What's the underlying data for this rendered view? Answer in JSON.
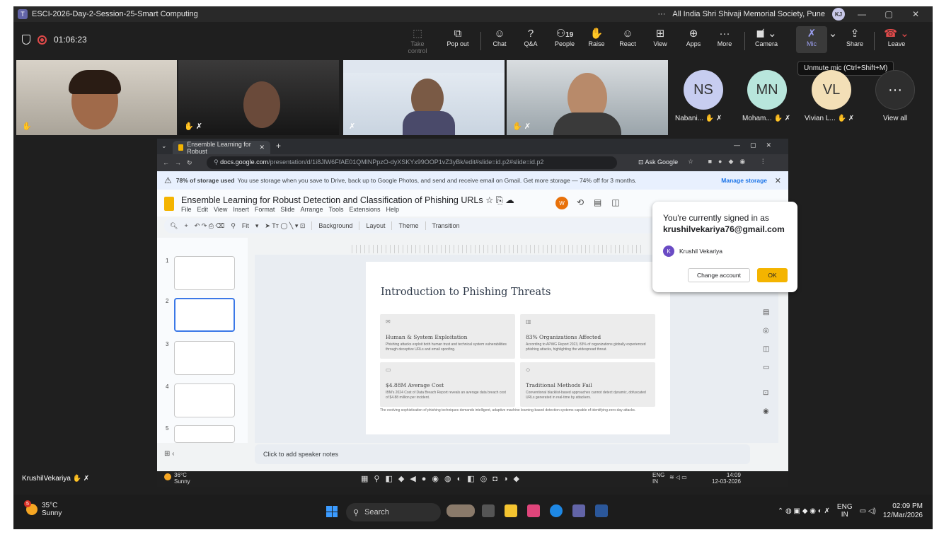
{
  "window": {
    "title": "ESCI-2026-Day-2-Session-25-Smart Computing",
    "org": "All India Shri Shivaji Memorial Society, Pune",
    "user_initials": "KJ"
  },
  "meeting": {
    "timer": "01:06:23"
  },
  "toolbar": {
    "take_control": "Take control",
    "pop_out": "Pop out",
    "chat": "Chat",
    "qa": "Q&A",
    "people": "People",
    "people_count": "19",
    "raise": "Raise",
    "react": "React",
    "view": "View",
    "apps": "Apps",
    "more": "More",
    "camera": "Camera",
    "mic": "Mic",
    "share": "Share",
    "leave": "Leave",
    "tooltip": "Unmute mic (Ctrl+Shift+M)"
  },
  "participants": [
    {
      "initials": "NS",
      "name": "Nabani...",
      "color": "#c7cdf0"
    },
    {
      "initials": "MN",
      "name": "Moham...",
      "color": "#b8e6dc"
    },
    {
      "initials": "VL",
      "name": "Vivian L...",
      "color": "#f3dfb7"
    }
  ],
  "view_all": "View all",
  "self_label": "KrushilVekariya",
  "browser": {
    "tab_title": "Ensemble Learning for Robust",
    "url_domain": "docs.google.com",
    "url_path": "/presentation/d/1i8JlW6FfAE01QMlNPpzO-dyXSKYx99OOP1vZ3yBk/edit#slide=id.p2#slide=id.p2",
    "ask_google": "Ask Google",
    "banner_strong": "78% of storage used",
    "banner_text": "You use storage when you save to Drive, back up to Google Photos, and send and receive email on Gmail. Get more storage — 74% off for 3 months.",
    "manage_storage": "Manage storage"
  },
  "doc": {
    "title": "Ensemble Learning for Robust Detection and Classification of Phishing URLs",
    "menus": [
      "File",
      "Edit",
      "View",
      "Insert",
      "Format",
      "Slide",
      "Arrange",
      "Tools",
      "Extensions",
      "Help"
    ],
    "edit_tools": {
      "fit": "Fit",
      "background": "Background",
      "layout": "Layout",
      "theme": "Theme",
      "transition": "Transition"
    },
    "slide_numbers": [
      "1",
      "2",
      "3",
      "4",
      "5"
    ],
    "speaker_notes": "Click to add speaker notes"
  },
  "slide": {
    "title": "Introduction to Phishing Threats",
    "cards": [
      {
        "heading": "Human & System Exploitation",
        "body": "Phishing attacks exploit both human trust and technical system vulnerabilities through deceptive URLs and email spoofing."
      },
      {
        "heading": "83% Organizations Affected",
        "body": "According to APWG Report 2023, 83% of organizations globally experienced phishing attacks, highlighting the widespread threat."
      },
      {
        "heading": "$4.88M Average Cost",
        "body": "IBM's 2024 Cost of Data Breach Report reveals an average data breach cost of $4.88 million per incident."
      },
      {
        "heading": "Traditional Methods Fail",
        "body": "Conventional blacklist-based approaches cannot detect dynamic, obfuscated URLs generated in real-time by attackers."
      }
    ],
    "footer": "The evolving sophistication of phishing techniques demands intelligent, adaptive machine learning-based detection systems capable of identifying zero-day attacks."
  },
  "popup": {
    "line1": "You're currently signed in as",
    "email": "krushilvekariya76@gmail.com",
    "name": "Krushil Vekariya",
    "avatar": "K",
    "change": "Change account",
    "ok": "OK"
  },
  "inner_taskbar": {
    "temp": "36°C",
    "weather": "Sunny",
    "lang": "ENG",
    "region": "IN",
    "time": "14:09",
    "date": "12-03-2026"
  },
  "taskbar": {
    "temp": "35°C",
    "weather": "Sunny",
    "badge": "5",
    "search": "Search",
    "lang": "ENG",
    "region": "IN",
    "time": "02:09 PM",
    "date": "12/Mar/2026"
  }
}
